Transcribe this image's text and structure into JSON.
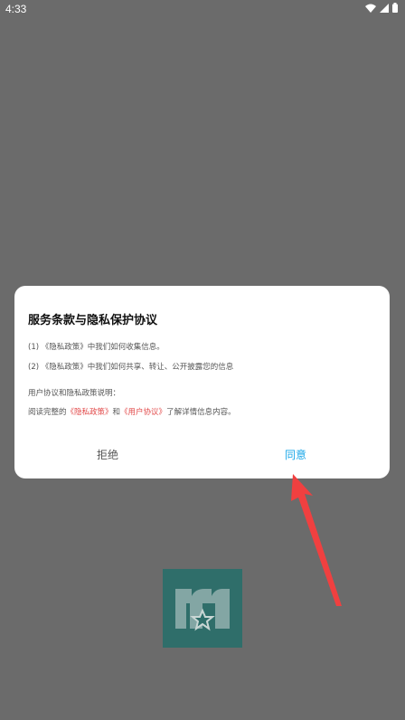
{
  "status_bar": {
    "time": "4:33"
  },
  "dialog": {
    "title": "服务条款与隐私保护协议",
    "line1": {
      "prefix": "(1) ",
      "doc": "《隐私政策》",
      "rest": "中我们如何收集信息。"
    },
    "line2": {
      "prefix": "(2) ",
      "doc": "《隐私政策》",
      "rest": "中我们如何共享、转让、公开披露您的信息"
    },
    "explain": "用户协议和隐私政策说明：",
    "read": {
      "pre": "阅读完整的",
      "privacy_link": "《隐私政策》",
      "and": "和",
      "user_link": "《用户协议》",
      "post": "了解详情信息内容。"
    },
    "reject_label": "拒绝",
    "agree_label": "同意"
  },
  "colors": {
    "accent": "#1aa7e8",
    "link_red": "#e24a4a",
    "overlay": "#6b6b6b"
  },
  "icons": [
    "wifi-icon",
    "signal-icon",
    "battery-icon",
    "red-arrow-pointer",
    "app-logo"
  ]
}
